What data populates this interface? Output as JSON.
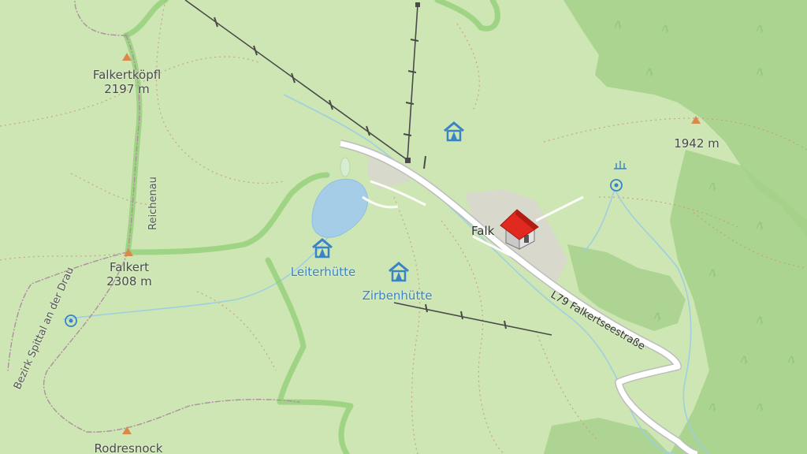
{
  "map": {
    "peaks": [
      {
        "name": "Falkertköpfl",
        "elevation": "2197 m"
      },
      {
        "name": "Falkert",
        "elevation": "2308 m"
      },
      {
        "name": "",
        "elevation": "1942 m"
      },
      {
        "name": "Rodresnock",
        "elevation": ""
      }
    ],
    "huts": [
      "Leiterhütte",
      "Zirbenhütte"
    ],
    "village": "Falk",
    "road": "L79 Falkertseestraße",
    "district_boundary": "Bezirk Spittal an der Drau",
    "locality": "Reichenau",
    "colors": {
      "meadow": "#cde6b4",
      "forest": "#a5d08a",
      "water": "#a6cde7",
      "road": "#ffffff",
      "hut_blue": "#3a84c4",
      "boundary_green": "#7dbf65"
    },
    "icons": [
      "peak-icon",
      "alpine-hut-icon",
      "hotel-icon",
      "spring-icon"
    ]
  }
}
